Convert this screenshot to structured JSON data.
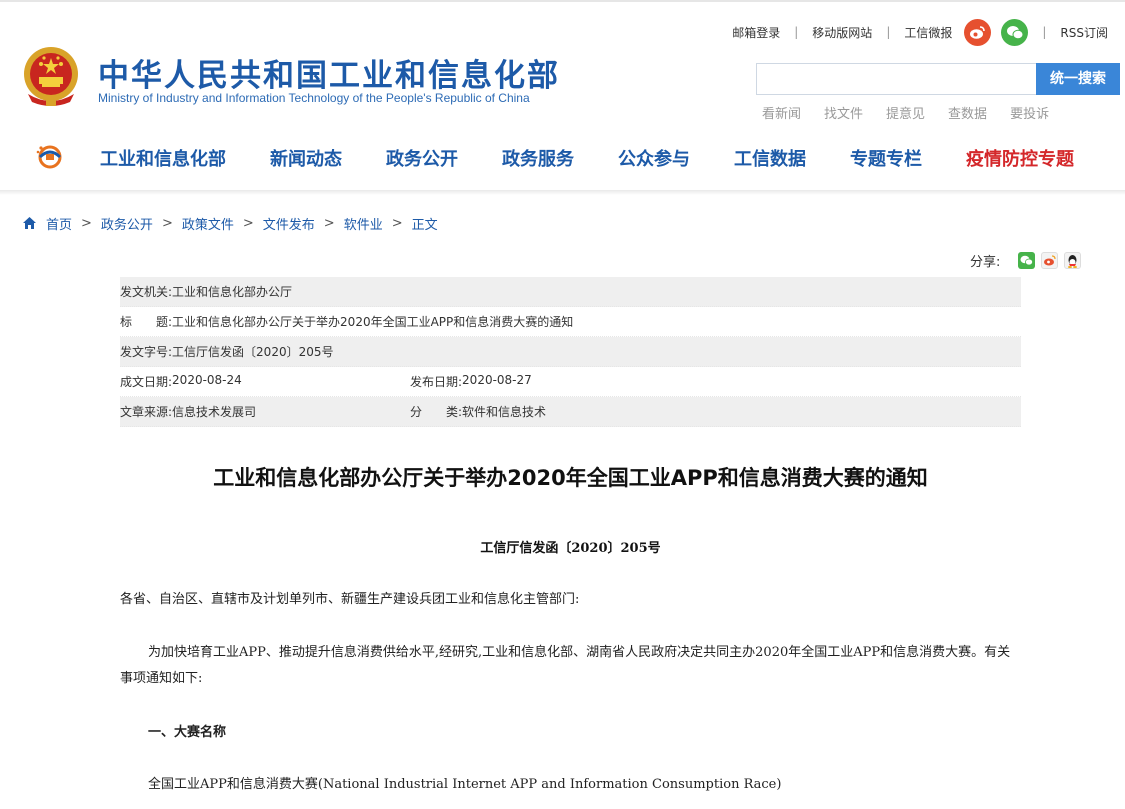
{
  "header": {
    "site_name_cn": "中华人民共和国工业和信息化部",
    "site_name_en": "Ministry of Industry and Information Technology of the People's Republic of China",
    "top_links": [
      "邮箱登录",
      "移动版网站",
      "工信微报"
    ],
    "rss": "RSS订阅",
    "search": {
      "value": "",
      "placeholder": "",
      "button": "统一搜索"
    },
    "quick_links": [
      "看新闻",
      "找文件",
      "提意见",
      "查数据",
      "要投诉"
    ]
  },
  "nav": {
    "items": [
      "工业和信息化部",
      "新闻动态",
      "政务公开",
      "政务服务",
      "公众参与",
      "工信数据",
      "专题专栏",
      "疫情防控专题"
    ]
  },
  "breadcrumb": [
    "首页",
    "政务公开",
    "政策文件",
    "文件发布",
    "软件业",
    "正文"
  ],
  "share": {
    "label": "分享:"
  },
  "meta": {
    "issuer_label": "发文机关:",
    "issuer": "工业和信息化部办公厅",
    "title_label": "标　　题:",
    "title": "工业和信息化部办公厅关于举办2020年全国工业APP和信息消费大赛的通知",
    "docno_label": "发文字号:",
    "docno": "工信厅信发函〔2020〕205号",
    "written_label": "成文日期:",
    "written": "2020-08-24",
    "published_label": "发布日期:",
    "published": "2020-08-27",
    "source_label": "文章来源:",
    "source": "信息技术发展司",
    "category_label": "分　　类:",
    "category": "软件和信息技术"
  },
  "article": {
    "title": "工业和信息化部办公厅关于举办2020年全国工业APP和信息消费大赛的通知",
    "docno": "工信厅信发函〔2020〕205号",
    "p1": "各省、自治区、直辖市及计划单列市、新疆生产建设兵团工业和信息化主管部门:",
    "p2": "为加快培育工业APP、推动提升信息消费供给水平,经研究,工业和信息化部、湖南省人民政府决定共同主办2020年全国工业APP和信息消费大赛。有关事项通知如下:",
    "h1": "一、大赛名称",
    "p3": "全国工业APP和信息消费大赛(National Industrial Internet APP and Information Consumption Race)"
  },
  "colors": {
    "brand_blue": "#1d5aa8",
    "search_button": "#3a86d8",
    "nav_highlight_red": "#d4272a",
    "weibo_red": "#e6502f",
    "wechat_green": "#46b34a"
  }
}
